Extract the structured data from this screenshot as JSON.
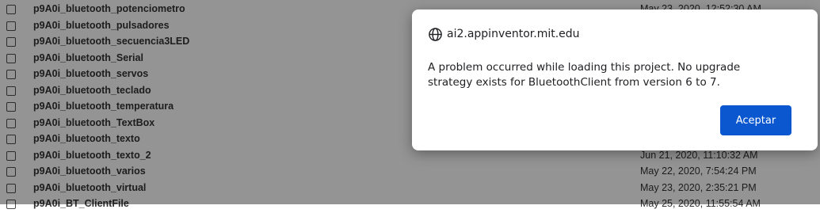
{
  "projects": [
    {
      "name": "p9A0i_bluetooth_potenciometro",
      "date": "May 23, 2020, 12:52:30 AM"
    },
    {
      "name": "p9A0i_bluetooth_pulsadores",
      "date": ""
    },
    {
      "name": "p9A0i_bluetooth_secuencia3LED",
      "date": ""
    },
    {
      "name": "p9A0i_bluetooth_Serial",
      "date": ""
    },
    {
      "name": "p9A0i_bluetooth_servos",
      "date": ""
    },
    {
      "name": "p9A0i_bluetooth_teclado",
      "date": ""
    },
    {
      "name": "p9A0i_bluetooth_temperatura",
      "date": ""
    },
    {
      "name": "p9A0i_bluetooth_TextBox",
      "date": ""
    },
    {
      "name": "p9A0i_bluetooth_texto",
      "date": ""
    },
    {
      "name": "p9A0i_bluetooth_texto_2",
      "date": "Jun 21, 2020, 11:10:32 AM"
    },
    {
      "name": "p9A0i_bluetooth_varios",
      "date": "May 22, 2020, 7:54:24 PM"
    },
    {
      "name": "p9A0i_bluetooth_virtual",
      "date": "May 23, 2020, 2:35:21 PM"
    },
    {
      "name": "p9A0i_BT_ClientFile",
      "date": "May 25, 2020, 11:55:54 AM"
    }
  ],
  "dialog": {
    "origin": "ai2.appinventor.mit.edu",
    "origin_icon": "globe-icon",
    "message": "A problem occurred while loading this project. No upgrade strategy exists for BluetoothClient from version 6 to 7.",
    "accept_label": "Aceptar",
    "accent_color": "#0b57d0"
  }
}
